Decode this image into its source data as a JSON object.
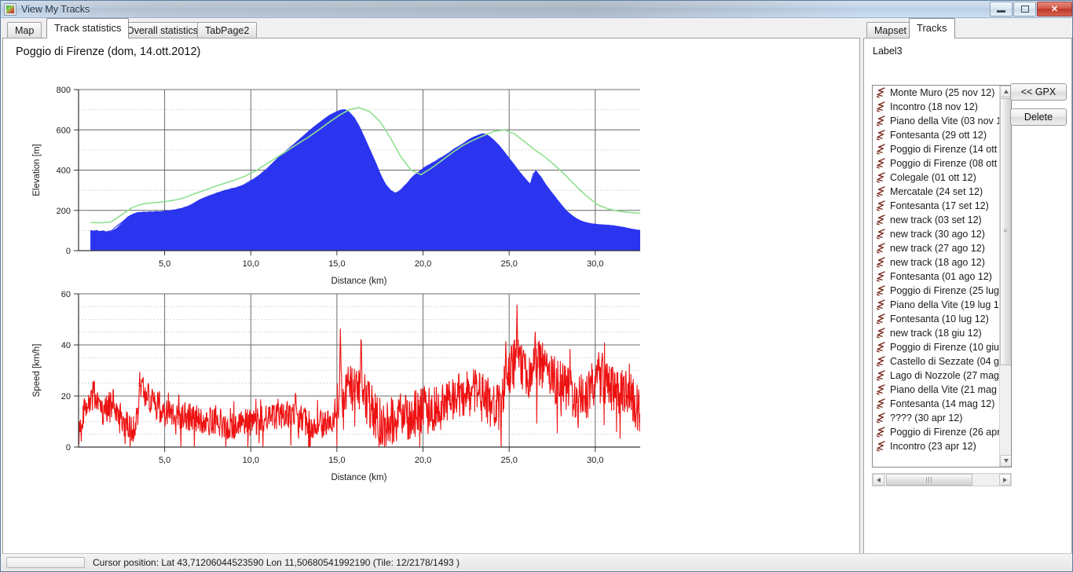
{
  "window": {
    "title": "View My Tracks",
    "icon": "app-icon",
    "minimize_label": "",
    "maximize_label": "",
    "close_label": "✕"
  },
  "left_panel": {
    "tabs": [
      {
        "label": "Map",
        "active": false
      },
      {
        "label": "Track statistics",
        "active": true
      },
      {
        "label": "Overall statistics",
        "active": false
      },
      {
        "label": "TabPage2",
        "active": false
      }
    ],
    "chart_title": "Poggio di Firenze (dom, 14.ott.2012)"
  },
  "right_panel": {
    "tabs": [
      {
        "label": "Mapset",
        "active": false
      },
      {
        "label": "Tracks",
        "active": true
      }
    ],
    "list_label": "Label3",
    "buttons": [
      {
        "label": "<< GPX"
      },
      {
        "label": "Delete"
      }
    ],
    "tracks": [
      "Monte Muro (25 nov 12)",
      "Incontro (18 nov 12)",
      "Piano della Vite (03 nov 1",
      "Fontesanta (29 ott 12)",
      "Poggio di Firenze (14 ott 1",
      "Poggio di Firenze (08 ott 1",
      "Colegale (01 ott 12)",
      "Mercatale (24 set 12)",
      "Fontesanta (17 set 12)",
      "new track (03 set 12)",
      "new track (30 ago 12)",
      "new track (27 ago 12)",
      "new track (18 ago 12)",
      "Fontesanta (01 ago 12)",
      "Poggio di Firenze (25 lug 1",
      "Piano della Vite (19 lug 12",
      "Fontesanta (10 lug 12)",
      "new track (18 giu 12)",
      "Poggio di Firenze (10 giu 1",
      "Castello di Sezzate (04 giu",
      "Lago di Nozzole (27 mag 1",
      "Piano della Vite (21 mag 1",
      "Fontesanta (14 mag 12)",
      "???? (30 apr 12)",
      "Poggio di Firenze (26 apr 1",
      "Incontro (23 apr 12)"
    ]
  },
  "statusbar": {
    "text": "Cursor position: Lat 43,71206044523590 Lon 11,50680541992190 (Tile: 12/2178/1493 )"
  },
  "colors": {
    "elevation_fill": "#2b35f0",
    "elevation_smooth": "#8fe08f",
    "speed_line": "#ee1111",
    "grid_major": "#666666",
    "grid_minor": "#c9b5b5",
    "accent": "#b9cde4"
  },
  "chart_data": [
    {
      "type": "area",
      "id": "elevation-chart",
      "title": "",
      "xlabel": "Distance (km)",
      "ylabel": "Elevation [m]",
      "xlim": [
        0,
        32.6
      ],
      "ylim": [
        0,
        800
      ],
      "xticks": [
        5.0,
        10.0,
        15.0,
        20.0,
        25.0,
        30.0
      ],
      "xticklabels": [
        "5,0",
        "10,0",
        "15,0",
        "20,0",
        "25,0",
        "30,0"
      ],
      "yticks": [
        0,
        200,
        400,
        600,
        800
      ],
      "yticklabels": [
        "0",
        "200",
        "400",
        "600",
        "800"
      ],
      "grid": true,
      "legend": "none",
      "series": [
        {
          "name": "Elevation",
          "color": "#2b35f0",
          "fill": true,
          "x": [
            0.0,
            0.3,
            0.6,
            0.9,
            1.2,
            1.5,
            1.8,
            2.1,
            2.4,
            2.7,
            3.0,
            3.3,
            3.6,
            3.9,
            4.2,
            4.5,
            4.8,
            5.1,
            5.4,
            5.7,
            6.0,
            6.3,
            6.6,
            6.9,
            7.2,
            7.5,
            7.8,
            8.1,
            8.4,
            8.7,
            9.0,
            9.3,
            9.6,
            9.9,
            10.2,
            10.5,
            10.8,
            11.1,
            11.4,
            11.7,
            12.0,
            12.3,
            12.6,
            12.9,
            13.2,
            13.5,
            13.8,
            14.1,
            14.4,
            14.7,
            15.0,
            15.3,
            15.6,
            15.9,
            16.2,
            16.5,
            16.8,
            17.1,
            17.4,
            17.7,
            18.0,
            18.3,
            18.6,
            18.9,
            19.2,
            19.5,
            19.8,
            20.1,
            20.4,
            20.7,
            21.0,
            21.3,
            21.6,
            21.9,
            22.2,
            22.5,
            22.8,
            23.1,
            23.4,
            23.7,
            24.0,
            24.3,
            24.6,
            24.9,
            25.2,
            25.5,
            25.8,
            26.1,
            26.4,
            26.7,
            27.0,
            27.3,
            27.6,
            27.9,
            28.2,
            28.5,
            28.8,
            29.1,
            29.4,
            29.7,
            30.0,
            30.3,
            30.6,
            30.9,
            31.2,
            31.5,
            31.8,
            32.1,
            32.4,
            32.6
          ],
          "y": [
            100,
            98,
            96,
            94,
            95,
            110,
            135,
            160,
            178,
            188,
            190,
            191,
            191,
            192,
            193,
            196,
            200,
            205,
            212,
            222,
            235,
            250,
            262,
            272,
            282,
            290,
            298,
            305,
            312,
            320,
            330,
            345,
            362,
            382,
            405,
            430,
            455,
            478,
            500,
            522,
            545,
            568,
            590,
            612,
            632,
            650,
            668,
            682,
            694,
            700,
            688,
            660,
            615,
            560,
            500,
            440,
            380,
            330,
            300,
            285,
            300,
            330,
            360,
            382,
            400,
            418,
            432,
            448,
            462,
            478,
            496,
            514,
            530,
            548,
            562,
            572,
            580,
            570,
            548,
            520,
            488,
            455,
            420,
            390,
            362,
            400,
            370,
            330,
            295,
            262,
            230,
            200,
            178,
            160,
            148,
            140,
            135,
            132,
            130,
            128,
            126,
            122,
            118,
            112,
            108,
            104,
            100,
            98,
            96,
            95
          ]
        },
        {
          "name": "Smoothed elevation",
          "color": "#8fe08f",
          "fill": false,
          "x": [
            0.0,
            0.6,
            1.2,
            1.8,
            2.4,
            3.0,
            3.6,
            4.2,
            4.8,
            5.4,
            6.0,
            6.6,
            7.2,
            7.8,
            8.4,
            9.0,
            9.6,
            10.2,
            10.8,
            11.4,
            12.0,
            12.6,
            13.2,
            13.8,
            14.4,
            15.0,
            15.6,
            16.2,
            16.8,
            17.4,
            18.0,
            18.6,
            19.2,
            19.8,
            20.4,
            21.0,
            21.6,
            22.2,
            22.8,
            23.4,
            24.0,
            24.6,
            25.2,
            25.8,
            26.4,
            27.0,
            27.6,
            28.2,
            28.8,
            29.4,
            30.0,
            30.6,
            31.2,
            31.8,
            32.4,
            32.6
          ],
          "y": [
            140,
            138,
            142,
            180,
            215,
            232,
            238,
            242,
            250,
            262,
            282,
            300,
            318,
            335,
            352,
            372,
            398,
            430,
            462,
            495,
            528,
            562,
            598,
            635,
            670,
            700,
            712,
            690,
            640,
            560,
            470,
            400,
            378,
            412,
            450,
            488,
            522,
            548,
            572,
            592,
            600,
            580,
            540,
            500,
            462,
            420,
            372,
            320,
            272,
            230,
            210,
            198,
            192,
            188,
            186,
            185
          ]
        }
      ]
    },
    {
      "type": "line",
      "id": "speed-chart",
      "title": "",
      "xlabel": "Distance (km)",
      "ylabel": "Speed [km/h]",
      "xlim": [
        0,
        32.6
      ],
      "ylim": [
        0,
        60
      ],
      "xticks": [
        5.0,
        10.0,
        15.0,
        20.0,
        25.0,
        30.0
      ],
      "xticklabels": [
        "5,0",
        "10,0",
        "15,0",
        "20,0",
        "25,0",
        "30,0"
      ],
      "yticks": [
        0,
        20,
        40,
        60
      ],
      "yticklabels": [
        "0",
        "20",
        "40",
        "60"
      ],
      "grid": true,
      "legend": "none",
      "series": [
        {
          "name": "Speed",
          "color": "#ee1111",
          "fill": false,
          "mean": 13,
          "max": 56,
          "min": 0,
          "note": "Noisy GPS speed trace: moderate 5-22 km/h for first 15 km, spikes to 30 near 3.5 km, dense 10-45 km/h oscillation from 15 to 32 km with maximum 56 km/h near 25.5 km"
        }
      ]
    }
  ]
}
